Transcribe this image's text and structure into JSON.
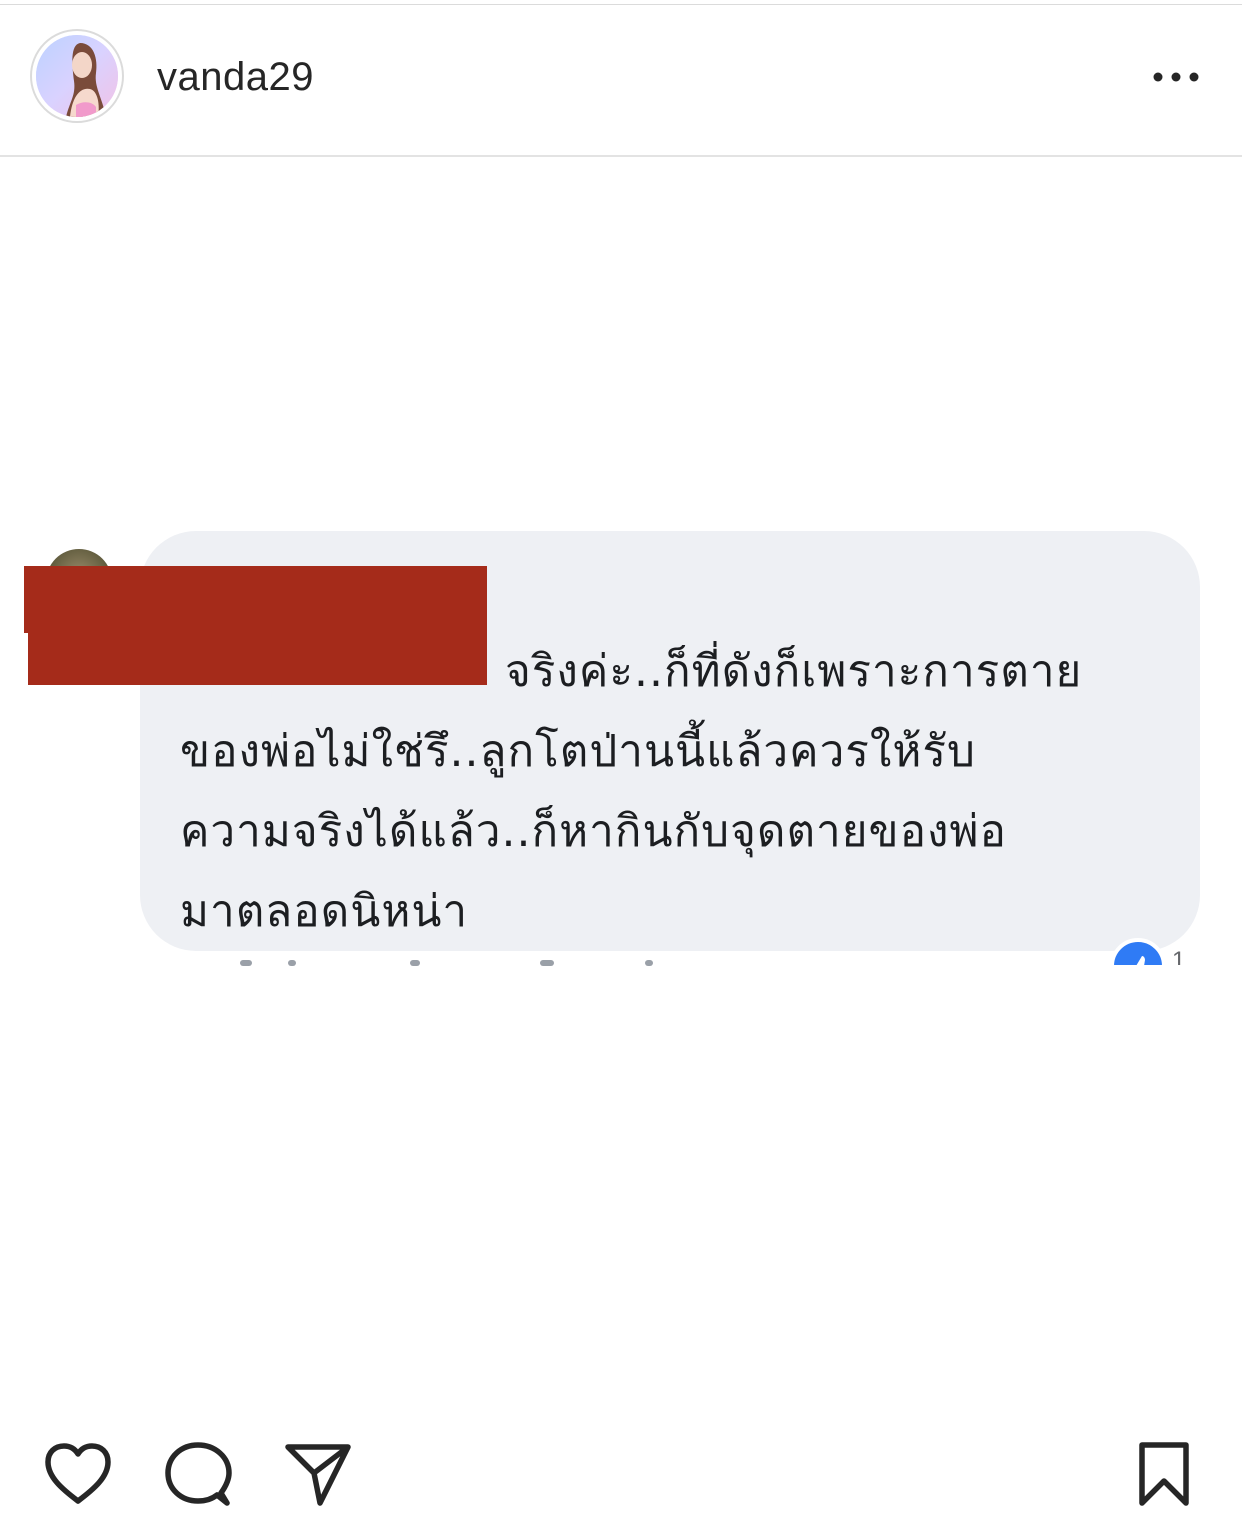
{
  "post": {
    "username": "vanda29",
    "more_label": "More options",
    "avatar_label": "Profile picture"
  },
  "image": {
    "comment_lines": [
      "จริงค่ะ..ก็ที่ดังก็เพราะการตาย",
      "ของพ่อไม่ใช่รึ..ลูกโตป่านนี้แล้วควรให้รับ",
      "ความจริงได้แล้ว..ก็หากินกับจุดตายของพ่อ",
      "มาตลอดนิหน่า"
    ],
    "like_count": "1",
    "redaction_color": "#a52b1a",
    "bubble_color": "#eef0f4"
  },
  "actions": {
    "like_icon": "heart-icon",
    "comment_icon": "comment-icon",
    "share_icon": "send-icon",
    "save_icon": "bookmark-icon"
  }
}
